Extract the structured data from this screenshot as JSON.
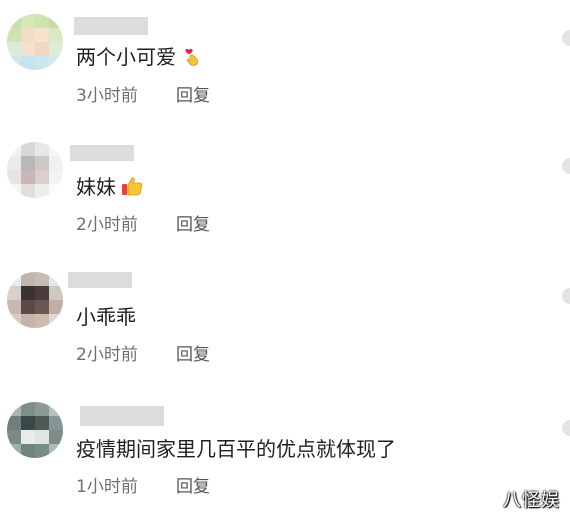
{
  "comments": [
    {
      "text": "两个小可爱",
      "emoji": "finger-heart-emoji",
      "time": "3小时前",
      "reply_label": "回复"
    },
    {
      "text": "妹妹",
      "emoji": "thumbs-up-emoji",
      "time": "2小时前",
      "reply_label": "回复"
    },
    {
      "text": "小乖乖",
      "emoji": "",
      "time": "2小时前",
      "reply_label": "回复"
    },
    {
      "text": "疫情期间家里几百平的优点就体现了",
      "emoji": "",
      "time": "1小时前",
      "reply_label": "回复"
    }
  ],
  "watermark": "八怪娱",
  "colors": {
    "meta_text": "#6f6f6f",
    "name_mask": "#dcdcdc",
    "side_dot": "#e4e4e4"
  }
}
